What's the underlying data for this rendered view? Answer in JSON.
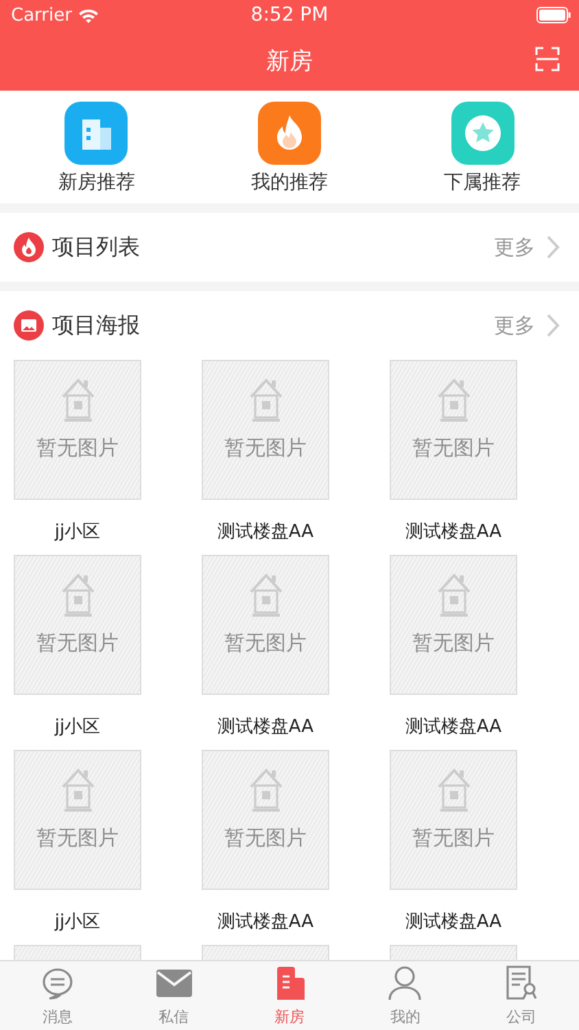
{
  "status_bar": {
    "carrier": "Carrier",
    "time": "8:52 PM"
  },
  "nav": {
    "title": "新房"
  },
  "shortcuts": [
    {
      "label": "新房推荐",
      "kind": "building"
    },
    {
      "label": "我的推荐",
      "kind": "flame"
    },
    {
      "label": "下属推荐",
      "kind": "star"
    }
  ],
  "sections": [
    {
      "title": "项目列表",
      "kind": "flame",
      "more": "更多"
    },
    {
      "title": "项目海报",
      "kind": "image",
      "more": "更多"
    }
  ],
  "posters": [
    {
      "kind": "empty",
      "placeholder": "暂无图片",
      "name": "jj小区"
    },
    {
      "kind": "empty",
      "placeholder": "暂无图片",
      "name": "测试楼盘AA"
    },
    {
      "kind": "empty",
      "placeholder": "暂无图片",
      "name": "测试楼盘AA"
    },
    {
      "kind": "empty",
      "placeholder": "暂无图片",
      "name": "jj小区"
    },
    {
      "kind": "empty",
      "placeholder": "暂无图片",
      "name": "测试楼盘AA"
    },
    {
      "kind": "empty",
      "placeholder": "暂无图片",
      "name": "测试楼盘AA"
    },
    {
      "kind": "empty",
      "placeholder": "暂无图片",
      "name": "jj小区"
    },
    {
      "kind": "empty",
      "placeholder": "暂无图片",
      "name": "测试楼盘AA"
    },
    {
      "kind": "empty",
      "placeholder": "暂无图片",
      "name": "测试楼盘AA"
    },
    {
      "kind": "cut"
    },
    {
      "kind": "cut"
    },
    {
      "kind": "cut"
    }
  ],
  "tab_bar": [
    {
      "label": "消息",
      "kind": "chat",
      "selected": false
    },
    {
      "label": "私信",
      "kind": "mail",
      "selected": false
    },
    {
      "label": "新房",
      "kind": "building",
      "selected": true
    },
    {
      "label": "我的",
      "kind": "person",
      "selected": false
    },
    {
      "label": "公司",
      "kind": "certificate",
      "selected": false
    }
  ]
}
